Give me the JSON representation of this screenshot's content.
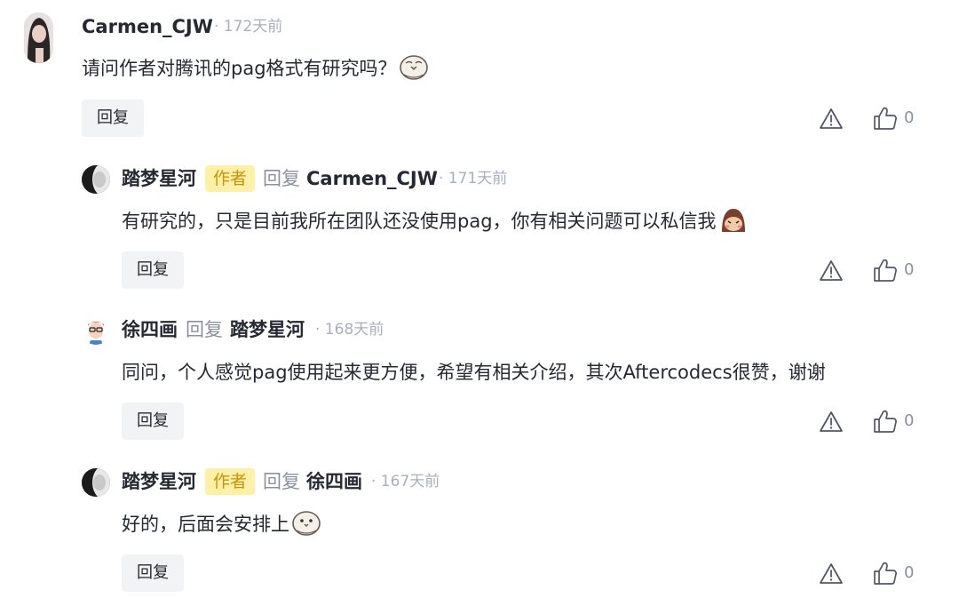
{
  "comments": [
    {
      "author": "Carmen_CJW",
      "is_author": false,
      "reply_to": "",
      "time": "· 172天前",
      "text": "请问作者对腾讯的pag格式有研究吗？",
      "emoji": "bird-emoji",
      "reply_label": "回复",
      "likes": "0"
    },
    {
      "author": "踏梦星河",
      "is_author": true,
      "author_badge": "作者",
      "reply_word": "回复",
      "reply_to": "Carmen_CJW",
      "time": "· 171天前",
      "text": "有研究的，只是目前我所在团队还没使用pag，你有相关问题可以私信我",
      "emoji": "shy-emoji",
      "reply_label": "回复",
      "likes": "0"
    },
    {
      "author": "徐四画",
      "is_author": false,
      "reply_word": "回复",
      "reply_to": "踏梦星河",
      "time": "· 168天前",
      "text": "同问，个人感觉pag使用起来更方便，希望有相关介绍，其次Aftercodecs很赞，谢谢",
      "emoji": "",
      "reply_label": "回复",
      "likes": "0"
    },
    {
      "author": "踏梦星河",
      "is_author": true,
      "author_badge": "作者",
      "reply_word": "回复",
      "reply_to": "徐四画",
      "time": "· 167天前",
      "text": "好的，后面会安排上",
      "emoji": "bird-emoji",
      "reply_label": "回复",
      "likes": "0"
    }
  ]
}
